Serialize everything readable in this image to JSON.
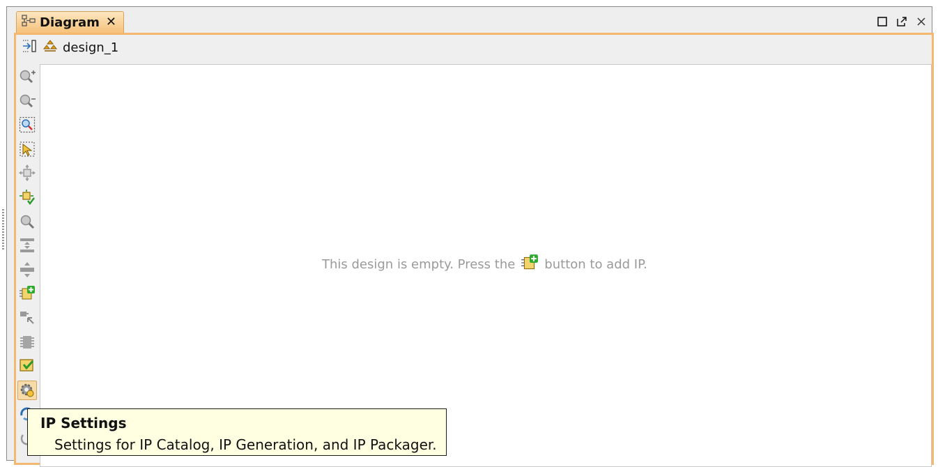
{
  "window": {
    "tab": {
      "title": "Diagram",
      "icon": "block-diagram-icon",
      "close_icon": "close-icon"
    },
    "controls": [
      {
        "name": "maximize",
        "icon": "maximize-icon"
      },
      {
        "name": "float",
        "icon": "float-window-icon"
      },
      {
        "name": "close",
        "icon": "close-icon"
      }
    ]
  },
  "toolbar": {
    "breadcrumb": "design_1",
    "breadcrumb_icon": "hierarchy-icon",
    "expand_icon": "expand-panel-icon"
  },
  "tools": [
    {
      "name": "zoom-in",
      "icon": "zoom-in-icon"
    },
    {
      "name": "zoom-out",
      "icon": "zoom-out-icon"
    },
    {
      "name": "zoom-area",
      "icon": "zoom-area-icon"
    },
    {
      "name": "select-area",
      "icon": "select-area-icon"
    },
    {
      "name": "fit-selection",
      "icon": "fit-selection-icon"
    },
    {
      "name": "auto-fit",
      "icon": "auto-fit-icon"
    },
    {
      "name": "search",
      "icon": "search-icon"
    },
    {
      "name": "collapse-all",
      "icon": "collapse-all-icon"
    },
    {
      "name": "expand-all",
      "icon": "expand-all-icon"
    },
    {
      "name": "add-ip",
      "icon": "add-ip-icon"
    },
    {
      "name": "make-external",
      "icon": "make-external-icon"
    },
    {
      "name": "add-module",
      "icon": "chip-icon"
    },
    {
      "name": "validate-design",
      "icon": "validate-icon"
    },
    {
      "name": "ip-settings",
      "icon": "settings-gear-icon",
      "active": true
    },
    {
      "name": "refresh",
      "icon": "refresh-icon"
    },
    {
      "name": "regenerate",
      "icon": "regenerate-icon"
    }
  ],
  "canvas": {
    "message_before": "This design is empty. Press the",
    "message_after": "button to add IP.",
    "message_icon": "add-ip-icon"
  },
  "tooltip": {
    "title": "IP Settings",
    "description": "Settings for IP Catalog, IP Generation, and IP Packager."
  },
  "colors": {
    "accent_orange": "#f5b870",
    "tooltip_bg": "#ffffe1",
    "muted_text": "#9a9a9a"
  }
}
